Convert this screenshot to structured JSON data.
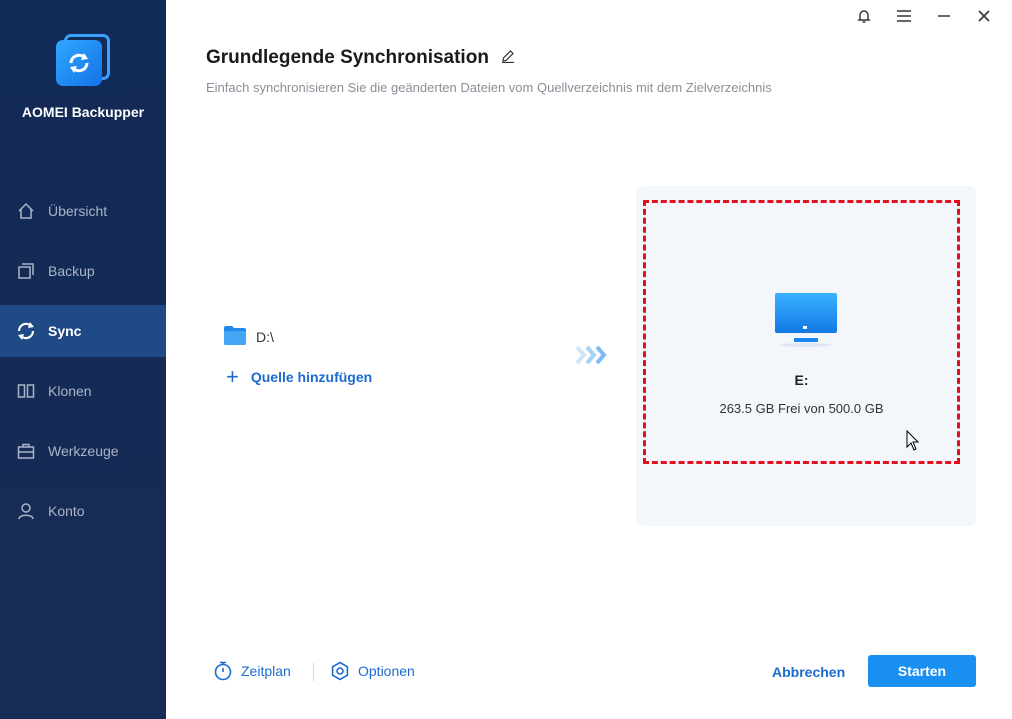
{
  "app": {
    "name": "AOMEI Backupper"
  },
  "sidebar": {
    "items": [
      {
        "label": "Übersicht",
        "icon": "home-icon",
        "active": false
      },
      {
        "label": "Backup",
        "icon": "backup-icon",
        "active": false
      },
      {
        "label": "Sync",
        "icon": "sync-icon",
        "active": true
      },
      {
        "label": "Klonen",
        "icon": "clone-icon",
        "active": false
      },
      {
        "label": "Werkzeuge",
        "icon": "toolbox-icon",
        "active": false
      },
      {
        "label": "Konto",
        "icon": "user-icon",
        "active": false
      }
    ]
  },
  "header": {
    "title": "Grundlegende Synchronisation",
    "subtitle": "Einfach synchronisieren Sie die geänderten Dateien vom Quellverzeichnis mit dem Zielverzeichnis"
  },
  "source": {
    "item": "D:\\",
    "add_label": "Quelle hinzufügen"
  },
  "destination": {
    "drive": "E:",
    "info": "263.5 GB Frei von 500.0 GB"
  },
  "footer": {
    "schedule": "Zeitplan",
    "options": "Optionen",
    "cancel": "Abbrechen",
    "start": "Starten"
  },
  "colors": {
    "sidebar_bg": "#122a57",
    "sidebar_active": "#1f4a86",
    "accent": "#1c6bd0",
    "start_button": "#1a8ff2",
    "highlight_border": "#e0101c"
  }
}
